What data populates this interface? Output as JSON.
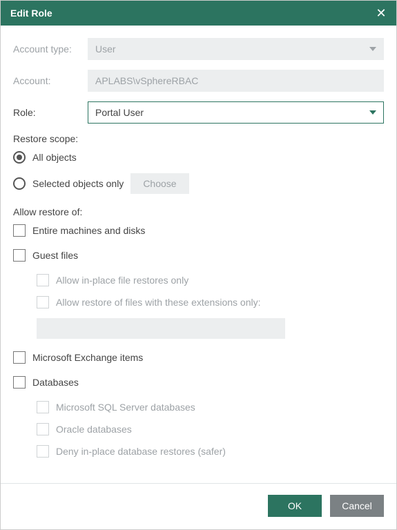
{
  "dialog": {
    "title": "Edit Role"
  },
  "fields": {
    "account_type": {
      "label": "Account type:",
      "value": "User",
      "disabled": true
    },
    "account": {
      "label": "Account:",
      "value": "APLABS\\vSphereRBAC",
      "disabled": true
    },
    "role": {
      "label": "Role:",
      "value": "Portal User"
    }
  },
  "restore_scope": {
    "label": "Restore scope:",
    "options": {
      "all": {
        "label": "All objects",
        "selected": true
      },
      "selected": {
        "label": "Selected objects only",
        "selected": false,
        "choose_label": "Choose"
      }
    }
  },
  "allow_restore_of": {
    "label": "Allow restore of:",
    "entire_machines": {
      "label": "Entire machines and disks",
      "checked": false
    },
    "guest_files": {
      "label": "Guest files",
      "checked": false,
      "sub": {
        "inplace_only": {
          "label": "Allow in-place file restores only"
        },
        "ext_only": {
          "label": "Allow restore of files with these extensions only:"
        },
        "ext_value": ""
      }
    },
    "exchange": {
      "label": "Microsoft Exchange items",
      "checked": false
    },
    "databases": {
      "label": "Databases",
      "checked": false,
      "sub": {
        "mssql": {
          "label": "Microsoft SQL Server databases"
        },
        "oracle": {
          "label": "Oracle databases"
        },
        "deny": {
          "label": "Deny in-place database restores (safer)"
        }
      }
    }
  },
  "buttons": {
    "ok": "OK",
    "cancel": "Cancel"
  }
}
